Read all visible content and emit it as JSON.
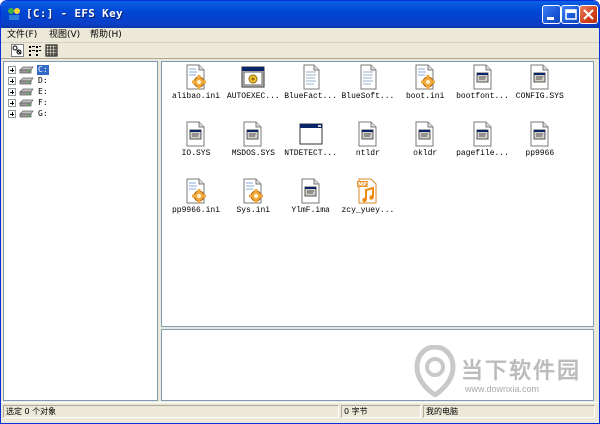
{
  "window": {
    "title": "[C:] - EFS Key"
  },
  "menubar": {
    "items": [
      {
        "label": "文件(F)"
      },
      {
        "label": "视图(V)"
      },
      {
        "label": "帮助(H)"
      }
    ]
  },
  "toolbar": {
    "buttons": [
      "find-icon",
      "list-view-icon",
      "detail-view-icon"
    ]
  },
  "tree": {
    "drives": [
      {
        "label": "C:",
        "selected": true
      },
      {
        "label": "D:"
      },
      {
        "label": "E:"
      },
      {
        "label": "F:"
      },
      {
        "label": "G:"
      }
    ]
  },
  "files": [
    {
      "name": "alibao.ini",
      "icon": "settings-file-icon"
    },
    {
      "name": "AUTOEXEC...",
      "icon": "batch-file-icon"
    },
    {
      "name": "BlueFact...",
      "icon": "text-file-icon"
    },
    {
      "name": "BlueSoft...",
      "icon": "text-file-icon"
    },
    {
      "name": "boot.ini",
      "icon": "settings-file-icon"
    },
    {
      "name": "bootfont...",
      "icon": "system-file-icon"
    },
    {
      "name": "CONFIG.SYS",
      "icon": "system-file-icon"
    },
    {
      "name": "IO.SYS",
      "icon": "system-file-icon"
    },
    {
      "name": "MSDOS.SYS",
      "icon": "system-file-icon"
    },
    {
      "name": "NTDETECT...",
      "icon": "app-window-icon"
    },
    {
      "name": "ntldr",
      "icon": "system-file-icon"
    },
    {
      "name": "okldr",
      "icon": "system-file-icon"
    },
    {
      "name": "pagefile...",
      "icon": "system-file-icon"
    },
    {
      "name": "pp9966",
      "icon": "system-file-icon"
    },
    {
      "name": "pp9966.ini",
      "icon": "settings-file-icon"
    },
    {
      "name": "Sys.ini",
      "icon": "settings-file-icon"
    },
    {
      "name": "YlmF.ima",
      "icon": "system-file-icon"
    },
    {
      "name": "zcy_yuey...",
      "icon": "mp3-file-icon"
    }
  ],
  "statusbar": {
    "selection": "选定 0 个对象",
    "size": "0 字节",
    "location": "我的电脑"
  },
  "watermark": {
    "name": "当下软件园",
    "url": "www.downxia.com"
  },
  "colors": {
    "titlebar": "#0046d5",
    "selection": "#316ac5",
    "close_button": "#d3411c"
  }
}
